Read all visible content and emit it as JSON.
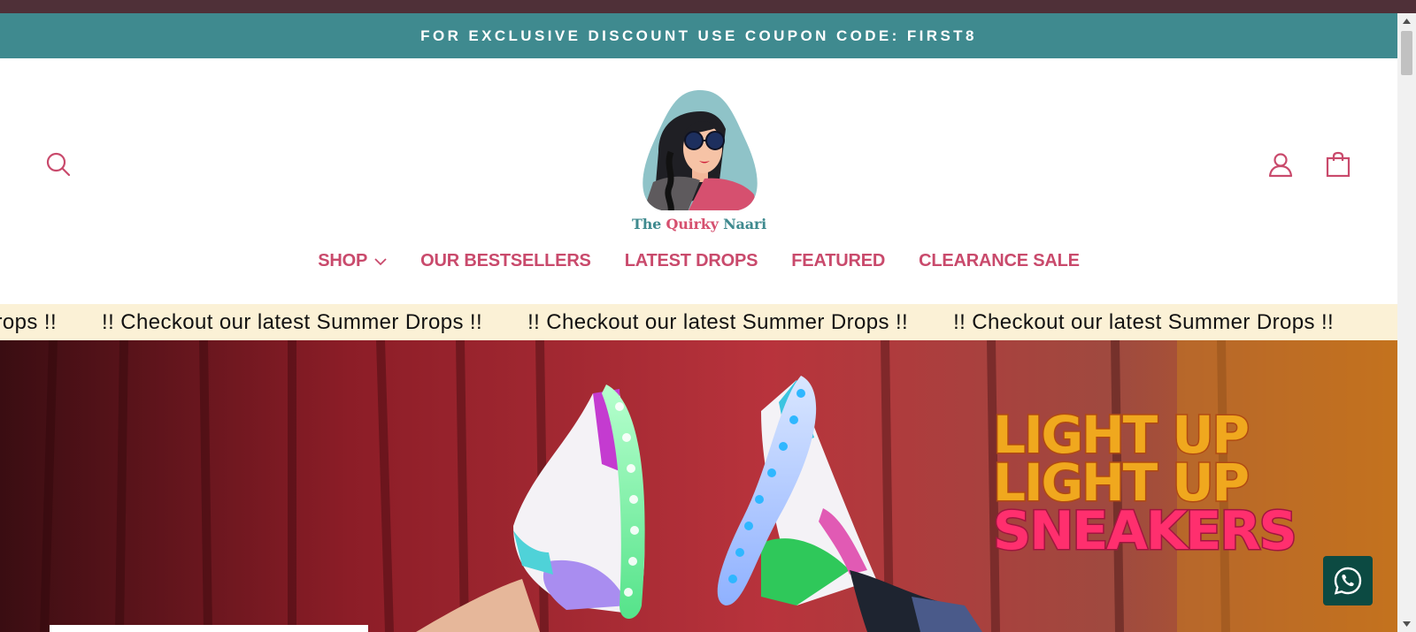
{
  "announcement": {
    "text": "FOR EXCLUSIVE DISCOUNT USE COUPON CODE: FIRST8"
  },
  "header": {
    "logo": {
      "brand_the": "The ",
      "brand_quirky": "Quirky",
      "brand_naari": " Naari"
    },
    "icons": {
      "search": "search-icon",
      "account": "user-icon",
      "cart": "shopping-bag-icon"
    }
  },
  "nav": {
    "items": [
      {
        "label": "SHOP"
      },
      {
        "label": "OUR BESTSELLERS"
      },
      {
        "label": "LATEST DROPS"
      },
      {
        "label": "FEATURED"
      },
      {
        "label": "CLEARANCE SALE"
      }
    ]
  },
  "marquee": {
    "text": "!! Checkout our latest Summer Drops !!"
  },
  "hero": {
    "line1": "LIGHT UP",
    "line2": "LIGHT UP",
    "line3": "SNEAKERS"
  },
  "colors": {
    "brand_teal": "#3f8a8f",
    "brand_pink": "#c94a6c",
    "marquee_bg": "#fbf1d6",
    "top_strip": "#4f3038",
    "whatsapp_bg": "#0c4a42"
  },
  "widgets": {
    "chat": "whatsapp-icon"
  }
}
